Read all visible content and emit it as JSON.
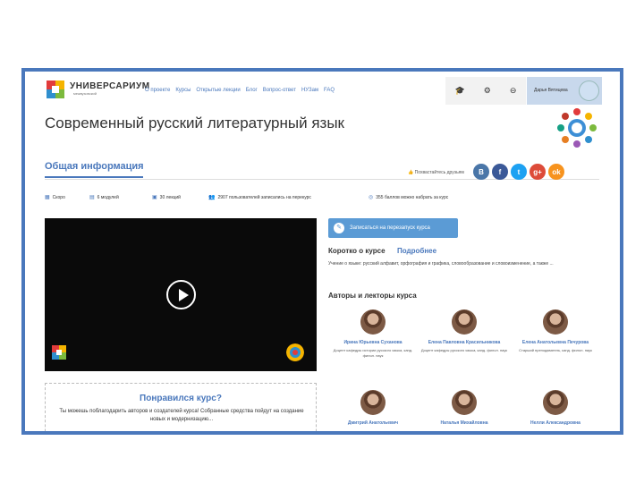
{
  "header": {
    "brand": "УНИВЕРСАРИУМ",
    "brand_sub": "межвузовский",
    "nav": [
      "О проекте",
      "Курсы",
      "Открытые лекции",
      "Блог",
      "Вопрос-ответ",
      "НУЗам",
      "FAQ"
    ],
    "user_name": "Дарья Вятицева",
    "icons": [
      "graduation-cap-icon",
      "gear-icon",
      "logout-icon"
    ]
  },
  "course": {
    "title": "Современный русский литературный язык",
    "tab": "Общая информация",
    "share_text": "Похвастайтесь друзьям",
    "socials": [
      {
        "label": "В",
        "color": "#4a76a8"
      },
      {
        "label": "f",
        "color": "#3b5998"
      },
      {
        "label": "t",
        "color": "#1da1f2"
      },
      {
        "label": "g+",
        "color": "#dd4b39"
      },
      {
        "label": "ok",
        "color": "#f7931e"
      }
    ],
    "stats": [
      "Скоро",
      "6 модулей",
      "30 лекций",
      "2907 пользователей записались на перекурс",
      "355 баллов можно набрать за курс"
    ],
    "enroll_label": "Записаться на перезапуск курса",
    "brief_label": "Коротко о курсе",
    "more_label": "Подробнее",
    "description": "Учение о языке: русский алфавит, орфография и графика, словообразование и словоизменение, а также ...",
    "authors_title": "Авторы и лекторы курса",
    "authors": [
      {
        "name": "Ирина Юрьевна Суханова",
        "role": "Доцент кафедры истории русского языка, канд. филол. наук"
      },
      {
        "name": "Елена Павловна Красильникова",
        "role": "Доцент кафедры русского языка, канд. филол. наук"
      },
      {
        "name": "Елена Анатольевна Печурова",
        "role": "Старший преподаватель, канд. филол. наук"
      },
      {
        "name": "Дмитрий Анатольевич",
        "role": ""
      },
      {
        "name": "Наталья Михайловна",
        "role": ""
      },
      {
        "name": "Нелли Александровна",
        "role": ""
      }
    ]
  },
  "promo": {
    "title": "Понравился курс?",
    "text": "Ты можешь поблагодарить авторов и создателей курса! Собранные средства пойдут на создание новых и модернизацию..."
  },
  "colors": {
    "accent": "#4a78bc",
    "frame": "#4a78bc",
    "video": "#0a0a0a"
  }
}
